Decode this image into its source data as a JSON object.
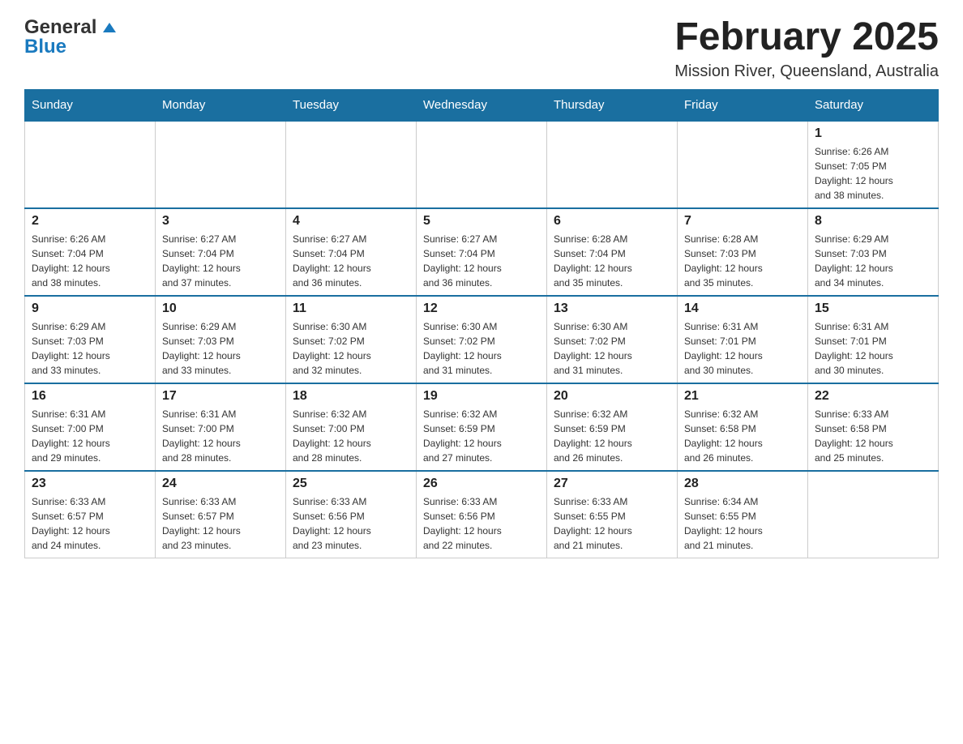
{
  "header": {
    "logo": {
      "general": "General",
      "blue": "Blue"
    },
    "title": "February 2025",
    "location": "Mission River, Queensland, Australia"
  },
  "weekdays": [
    "Sunday",
    "Monday",
    "Tuesday",
    "Wednesday",
    "Thursday",
    "Friday",
    "Saturday"
  ],
  "weeks": [
    [
      {
        "day": "",
        "info": ""
      },
      {
        "day": "",
        "info": ""
      },
      {
        "day": "",
        "info": ""
      },
      {
        "day": "",
        "info": ""
      },
      {
        "day": "",
        "info": ""
      },
      {
        "day": "",
        "info": ""
      },
      {
        "day": "1",
        "info": "Sunrise: 6:26 AM\nSunset: 7:05 PM\nDaylight: 12 hours\nand 38 minutes."
      }
    ],
    [
      {
        "day": "2",
        "info": "Sunrise: 6:26 AM\nSunset: 7:04 PM\nDaylight: 12 hours\nand 38 minutes."
      },
      {
        "day": "3",
        "info": "Sunrise: 6:27 AM\nSunset: 7:04 PM\nDaylight: 12 hours\nand 37 minutes."
      },
      {
        "day": "4",
        "info": "Sunrise: 6:27 AM\nSunset: 7:04 PM\nDaylight: 12 hours\nand 36 minutes."
      },
      {
        "day": "5",
        "info": "Sunrise: 6:27 AM\nSunset: 7:04 PM\nDaylight: 12 hours\nand 36 minutes."
      },
      {
        "day": "6",
        "info": "Sunrise: 6:28 AM\nSunset: 7:04 PM\nDaylight: 12 hours\nand 35 minutes."
      },
      {
        "day": "7",
        "info": "Sunrise: 6:28 AM\nSunset: 7:03 PM\nDaylight: 12 hours\nand 35 minutes."
      },
      {
        "day": "8",
        "info": "Sunrise: 6:29 AM\nSunset: 7:03 PM\nDaylight: 12 hours\nand 34 minutes."
      }
    ],
    [
      {
        "day": "9",
        "info": "Sunrise: 6:29 AM\nSunset: 7:03 PM\nDaylight: 12 hours\nand 33 minutes."
      },
      {
        "day": "10",
        "info": "Sunrise: 6:29 AM\nSunset: 7:03 PM\nDaylight: 12 hours\nand 33 minutes."
      },
      {
        "day": "11",
        "info": "Sunrise: 6:30 AM\nSunset: 7:02 PM\nDaylight: 12 hours\nand 32 minutes."
      },
      {
        "day": "12",
        "info": "Sunrise: 6:30 AM\nSunset: 7:02 PM\nDaylight: 12 hours\nand 31 minutes."
      },
      {
        "day": "13",
        "info": "Sunrise: 6:30 AM\nSunset: 7:02 PM\nDaylight: 12 hours\nand 31 minutes."
      },
      {
        "day": "14",
        "info": "Sunrise: 6:31 AM\nSunset: 7:01 PM\nDaylight: 12 hours\nand 30 minutes."
      },
      {
        "day": "15",
        "info": "Sunrise: 6:31 AM\nSunset: 7:01 PM\nDaylight: 12 hours\nand 30 minutes."
      }
    ],
    [
      {
        "day": "16",
        "info": "Sunrise: 6:31 AM\nSunset: 7:00 PM\nDaylight: 12 hours\nand 29 minutes."
      },
      {
        "day": "17",
        "info": "Sunrise: 6:31 AM\nSunset: 7:00 PM\nDaylight: 12 hours\nand 28 minutes."
      },
      {
        "day": "18",
        "info": "Sunrise: 6:32 AM\nSunset: 7:00 PM\nDaylight: 12 hours\nand 28 minutes."
      },
      {
        "day": "19",
        "info": "Sunrise: 6:32 AM\nSunset: 6:59 PM\nDaylight: 12 hours\nand 27 minutes."
      },
      {
        "day": "20",
        "info": "Sunrise: 6:32 AM\nSunset: 6:59 PM\nDaylight: 12 hours\nand 26 minutes."
      },
      {
        "day": "21",
        "info": "Sunrise: 6:32 AM\nSunset: 6:58 PM\nDaylight: 12 hours\nand 26 minutes."
      },
      {
        "day": "22",
        "info": "Sunrise: 6:33 AM\nSunset: 6:58 PM\nDaylight: 12 hours\nand 25 minutes."
      }
    ],
    [
      {
        "day": "23",
        "info": "Sunrise: 6:33 AM\nSunset: 6:57 PM\nDaylight: 12 hours\nand 24 minutes."
      },
      {
        "day": "24",
        "info": "Sunrise: 6:33 AM\nSunset: 6:57 PM\nDaylight: 12 hours\nand 23 minutes."
      },
      {
        "day": "25",
        "info": "Sunrise: 6:33 AM\nSunset: 6:56 PM\nDaylight: 12 hours\nand 23 minutes."
      },
      {
        "day": "26",
        "info": "Sunrise: 6:33 AM\nSunset: 6:56 PM\nDaylight: 12 hours\nand 22 minutes."
      },
      {
        "day": "27",
        "info": "Sunrise: 6:33 AM\nSunset: 6:55 PM\nDaylight: 12 hours\nand 21 minutes."
      },
      {
        "day": "28",
        "info": "Sunrise: 6:34 AM\nSunset: 6:55 PM\nDaylight: 12 hours\nand 21 minutes."
      },
      {
        "day": "",
        "info": ""
      }
    ]
  ]
}
